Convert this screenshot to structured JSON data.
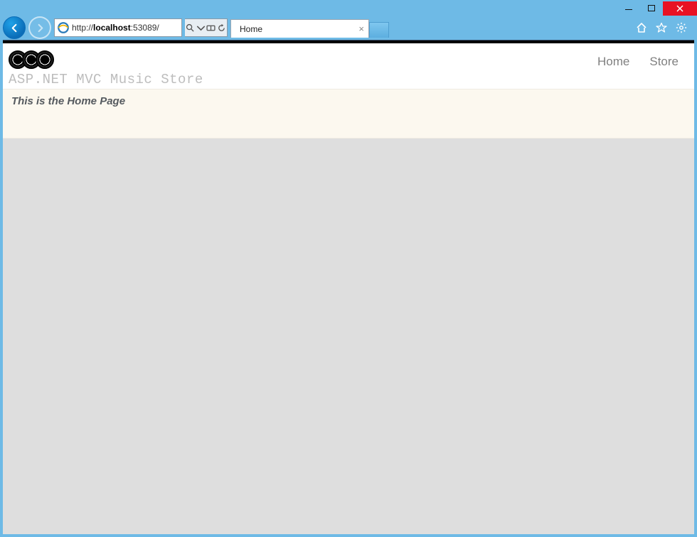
{
  "window": {
    "minimize_label": "Minimize",
    "maximize_label": "Maximize",
    "close_label": "Close"
  },
  "browser": {
    "url_display_prefix": "http://",
    "url_display_host": "localhost",
    "url_display_port": ":53089/",
    "tab_title": "Home",
    "tool_icons": {
      "home": "home-icon",
      "favorites": "star-icon",
      "settings": "gear-icon"
    }
  },
  "page": {
    "site_title": "ASP.NET MVC Music Store",
    "nav": [
      {
        "label": "Home"
      },
      {
        "label": "Store"
      }
    ],
    "content_heading": "This is the Home Page"
  }
}
